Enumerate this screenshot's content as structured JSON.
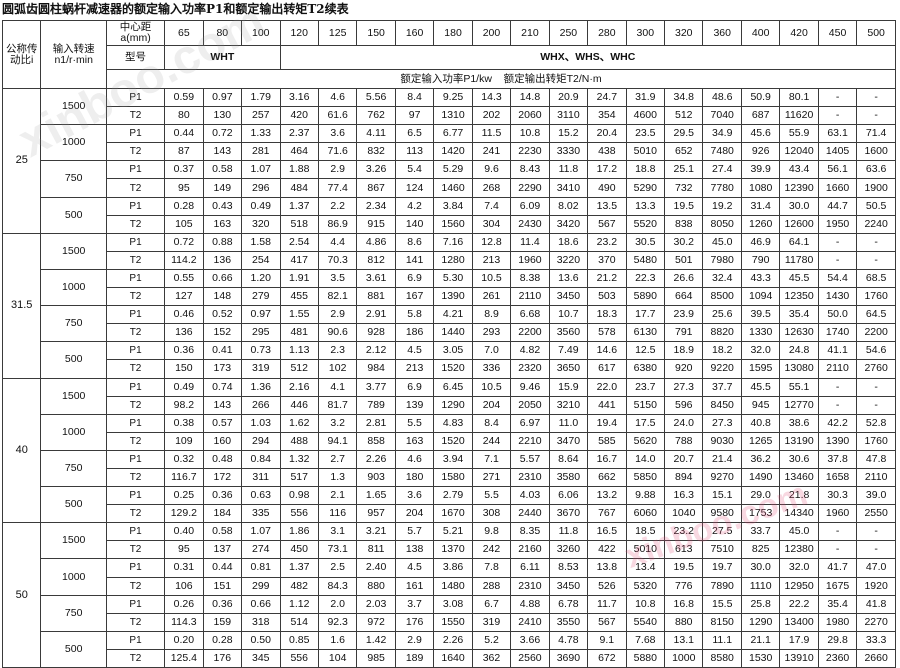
{
  "title": "圆弧齿圆柱蜗杆减速器的额定输入功率P1和额定输出转矩T2续表",
  "watermark_text": "xinboo.com",
  "header": {
    "ratio_label": "公称传动比i",
    "speed_label": "输入转速n1/r·min",
    "center_distance_label": "中心距a(mm)",
    "model_label": "型号",
    "center_distances": [
      "65",
      "80",
      "100",
      "120",
      "125",
      "150",
      "160",
      "180",
      "200",
      "210",
      "250",
      "280",
      "300",
      "320",
      "360",
      "400",
      "420",
      "450",
      "500"
    ],
    "models": [
      "WHT",
      "WHX、WHS、WHC"
    ],
    "units_caption": "额定输入功率P1/kw    额定输出转矩T2/N·m"
  },
  "groups": [
    {
      "ratio": "25",
      "speeds": [
        {
          "speed": "1500",
          "rows": [
            {
              "label": "P1",
              "values": [
                "0.59",
                "0.97",
                "1.79",
                "3.16",
                "4.6",
                "5.56",
                "8.4",
                "9.25",
                "14.3",
                "14.8",
                "20.9",
                "24.7",
                "31.9",
                "34.8",
                "48.6",
                "50.9",
                "80.1",
                "-",
                "-"
              ]
            },
            {
              "label": "T2",
              "values": [
                "80",
                "130",
                "257",
                "420",
                "61.6",
                "762",
                "97",
                "1310",
                "202",
                "2060",
                "3110",
                "354",
                "4600",
                "512",
                "7040",
                "687",
                "11620",
                "-",
                "-"
              ]
            }
          ]
        },
        {
          "speed": "1000",
          "rows": [
            {
              "label": "P1",
              "values": [
                "0.44",
                "0.72",
                "1.33",
                "2.37",
                "3.6",
                "4.11",
                "6.5",
                "6.77",
                "11.5",
                "10.8",
                "15.2",
                "20.4",
                "23.5",
                "29.5",
                "34.9",
                "45.6",
                "55.9",
                "63.1",
                "71.4"
              ]
            },
            {
              "label": "T2",
              "values": [
                "87",
                "143",
                "281",
                "464",
                "71.6",
                "832",
                "113",
                "1420",
                "241",
                "2230",
                "3330",
                "438",
                "5010",
                "652",
                "7480",
                "926",
                "12040",
                "1405",
                "1600"
              ]
            }
          ]
        },
        {
          "speed": "750",
          "rows": [
            {
              "label": "P1",
              "values": [
                "0.37",
                "0.58",
                "1.07",
                "1.88",
                "2.9",
                "3.26",
                "5.4",
                "5.29",
                "9.6",
                "8.43",
                "11.8",
                "17.2",
                "18.8",
                "25.1",
                "27.4",
                "39.9",
                "43.4",
                "56.1",
                "63.6"
              ]
            },
            {
              "label": "T2",
              "values": [
                "95",
                "149",
                "296",
                "484",
                "77.4",
                "867",
                "124",
                "1460",
                "268",
                "2290",
                "3410",
                "490",
                "5290",
                "732",
                "7780",
                "1080",
                "12390",
                "1660",
                "1900"
              ]
            }
          ]
        },
        {
          "speed": "500",
          "rows": [
            {
              "label": "P1",
              "values": [
                "0.28",
                "0.43",
                "0.49",
                "1.37",
                "2.2",
                "2.34",
                "4.2",
                "3.84",
                "7.4",
                "6.09",
                "8.02",
                "13.5",
                "13.3",
                "19.5",
                "19.2",
                "31.4",
                "30.0",
                "44.7",
                "50.5"
              ]
            },
            {
              "label": "T2",
              "values": [
                "105",
                "163",
                "320",
                "518",
                "86.9",
                "915",
                "140",
                "1560",
                "304",
                "2430",
                "3420",
                "567",
                "5520",
                "838",
                "8050",
                "1260",
                "12600",
                "1950",
                "2240"
              ]
            }
          ]
        }
      ]
    },
    {
      "ratio": "31.5",
      "speeds": [
        {
          "speed": "1500",
          "rows": [
            {
              "label": "P1",
              "values": [
                "0.72",
                "0.88",
                "1.58",
                "2.54",
                "4.4",
                "4.86",
                "8.6",
                "7.16",
                "12.8",
                "11.4",
                "18.6",
                "23.2",
                "30.5",
                "30.2",
                "45.0",
                "46.9",
                "64.1",
                "-",
                "-"
              ]
            },
            {
              "label": "T2",
              "values": [
                "114.2",
                "136",
                "254",
                "417",
                "70.3",
                "812",
                "141",
                "1280",
                "213",
                "1960",
                "3220",
                "370",
                "5480",
                "501",
                "7980",
                "790",
                "11780",
                "-",
                "-"
              ]
            }
          ]
        },
        {
          "speed": "1000",
          "rows": [
            {
              "label": "P1",
              "values": [
                "0.55",
                "0.66",
                "1.20",
                "1.91",
                "3.5",
                "3.61",
                "6.9",
                "5.30",
                "10.5",
                "8.38",
                "13.6",
                "21.2",
                "22.3",
                "26.6",
                "32.4",
                "43.3",
                "45.5",
                "54.4",
                "68.5"
              ]
            },
            {
              "label": "T2",
              "values": [
                "127",
                "148",
                "279",
                "455",
                "82.1",
                "881",
                "167",
                "1390",
                "261",
                "2110",
                "3450",
                "503",
                "5890",
                "664",
                "8500",
                "1094",
                "12350",
                "1430",
                "1760"
              ]
            }
          ]
        },
        {
          "speed": "750",
          "rows": [
            {
              "label": "P1",
              "values": [
                "0.46",
                "0.52",
                "0.97",
                "1.55",
                "2.9",
                "2.91",
                "5.8",
                "4.21",
                "8.9",
                "6.68",
                "10.7",
                "18.3",
                "17.7",
                "23.9",
                "25.6",
                "39.5",
                "35.4",
                "50.0",
                "64.5"
              ]
            },
            {
              "label": "T2",
              "values": [
                "136",
                "152",
                "295",
                "481",
                "90.6",
                "928",
                "186",
                "1440",
                "293",
                "2200",
                "3560",
                "578",
                "6130",
                "791",
                "8820",
                "1330",
                "12630",
                "1740",
                "2200"
              ]
            }
          ]
        },
        {
          "speed": "500",
          "rows": [
            {
              "label": "P1",
              "values": [
                "0.36",
                "0.41",
                "0.73",
                "1.13",
                "2.3",
                "2.12",
                "4.5",
                "3.05",
                "7.0",
                "4.82",
                "7.49",
                "14.6",
                "12.5",
                "18.9",
                "18.2",
                "32.0",
                "24.8",
                "41.1",
                "54.6"
              ]
            },
            {
              "label": "T2",
              "values": [
                "150",
                "173",
                "319",
                "512",
                "102",
                "984",
                "213",
                "1520",
                "336",
                "2320",
                "3650",
                "617",
                "6380",
                "920",
                "9220",
                "1595",
                "13080",
                "2110",
                "2760"
              ]
            }
          ]
        }
      ]
    },
    {
      "ratio": "40",
      "speeds": [
        {
          "speed": "1500",
          "rows": [
            {
              "label": "P1",
              "values": [
                "0.49",
                "0.74",
                "1.36",
                "2.16",
                "4.1",
                "3.77",
                "6.9",
                "6.45",
                "10.5",
                "9.46",
                "15.9",
                "22.0",
                "23.7",
                "27.3",
                "37.7",
                "45.5",
                "55.1",
                "-",
                "-"
              ]
            },
            {
              "label": "T2",
              "values": [
                "98.2",
                "143",
                "266",
                "446",
                "81.7",
                "789",
                "139",
                "1290",
                "204",
                "2050",
                "3210",
                "441",
                "5150",
                "596",
                "8450",
                "945",
                "12770",
                "-",
                "-"
              ]
            }
          ]
        },
        {
          "speed": "1000",
          "rows": [
            {
              "label": "P1",
              "values": [
                "0.38",
                "0.57",
                "1.03",
                "1.62",
                "3.2",
                "2.81",
                "5.5",
                "4.83",
                "8.4",
                "6.97",
                "11.0",
                "19.4",
                "17.5",
                "24.0",
                "27.3",
                "40.8",
                "38.6",
                "42.2",
                "52.8"
              ]
            },
            {
              "label": "T2",
              "values": [
                "109",
                "160",
                "294",
                "488",
                "94.1",
                "858",
                "163",
                "1520",
                "244",
                "2210",
                "3470",
                "585",
                "5620",
                "788",
                "9030",
                "1265",
                "13190",
                "1390",
                "1760"
              ]
            }
          ]
        },
        {
          "speed": "750",
          "rows": [
            {
              "label": "P1",
              "values": [
                "0.32",
                "0.48",
                "0.84",
                "1.32",
                "2.7",
                "2.26",
                "4.6",
                "3.94",
                "7.1",
                "5.57",
                "8.64",
                "16.7",
                "14.0",
                "20.7",
                "21.4",
                "36.2",
                "30.6",
                "37.8",
                "47.8"
              ]
            },
            {
              "label": "T2",
              "values": [
                "116.7",
                "172",
                "311",
                "517",
                "1.3",
                "903",
                "180",
                "1580",
                "271",
                "2310",
                "3580",
                "662",
                "5850",
                "894",
                "9270",
                "1490",
                "13460",
                "1658",
                "2110"
              ]
            }
          ]
        },
        {
          "speed": "500",
          "rows": [
            {
              "label": "P1",
              "values": [
                "0.25",
                "0.36",
                "0.63",
                "0.98",
                "2.1",
                "1.65",
                "3.6",
                "2.79",
                "5.5",
                "4.03",
                "6.06",
                "13.2",
                "9.88",
                "16.3",
                "15.1",
                "29.0",
                "21.8",
                "30.3",
                "39.0"
              ]
            },
            {
              "label": "T2",
              "values": [
                "129.2",
                "184",
                "335",
                "556",
                "116",
                "957",
                "204",
                "1670",
                "308",
                "2440",
                "3670",
                "767",
                "6060",
                "1040",
                "9580",
                "1753",
                "14340",
                "1960",
                "2550"
              ]
            }
          ]
        }
      ]
    },
    {
      "ratio": "50",
      "speeds": [
        {
          "speed": "1500",
          "rows": [
            {
              "label": "P1",
              "values": [
                "0.40",
                "0.58",
                "1.07",
                "1.86",
                "3.1",
                "3.21",
                "5.7",
                "5.21",
                "9.8",
                "8.35",
                "11.8",
                "16.5",
                "18.5",
                "23.2",
                "27.5",
                "33.7",
                "45.0",
                "-",
                "-"
              ]
            },
            {
              "label": "T2",
              "values": [
                "95",
                "137",
                "274",
                "450",
                "73.1",
                "811",
                "138",
                "1370",
                "242",
                "2160",
                "3260",
                "422",
                "5010",
                "613",
                "7510",
                "825",
                "12380",
                "-",
                "-"
              ]
            }
          ]
        },
        {
          "speed": "1000",
          "rows": [
            {
              "label": "P1",
              "values": [
                "0.31",
                "0.44",
                "0.81",
                "1.37",
                "2.5",
                "2.40",
                "4.5",
                "3.86",
                "7.8",
                "6.11",
                "8.53",
                "13.8",
                "13.4",
                "19.5",
                "19.7",
                "30.0",
                "32.0",
                "41.7",
                "47.0"
              ]
            },
            {
              "label": "T2",
              "values": [
                "106",
                "151",
                "299",
                "482",
                "84.3",
                "880",
                "161",
                "1480",
                "288",
                "2310",
                "3450",
                "526",
                "5320",
                "776",
                "7890",
                "1110",
                "12950",
                "1675",
                "1920"
              ]
            }
          ]
        },
        {
          "speed": "750",
          "rows": [
            {
              "label": "P1",
              "values": [
                "0.26",
                "0.36",
                "0.66",
                "1.12",
                "2.0",
                "2.03",
                "3.7",
                "3.08",
                "6.7",
                "4.88",
                "6.78",
                "11.7",
                "10.8",
                "16.8",
                "15.5",
                "25.8",
                "22.2",
                "35.4",
                "41.8"
              ]
            },
            {
              "label": "T2",
              "values": [
                "114.3",
                "159",
                "318",
                "514",
                "92.3",
                "972",
                "176",
                "1550",
                "319",
                "2410",
                "3550",
                "567",
                "5540",
                "880",
                "8150",
                "1290",
                "13400",
                "1980",
                "2270"
              ]
            }
          ]
        },
        {
          "speed": "500",
          "rows": [
            {
              "label": "P1",
              "values": [
                "0.20",
                "0.28",
                "0.50",
                "0.85",
                "1.6",
                "1.42",
                "2.9",
                "2.26",
                "5.2",
                "3.66",
                "4.78",
                "9.1",
                "7.68",
                "13.1",
                "11.1",
                "21.1",
                "17.9",
                "29.8",
                "33.3"
              ]
            },
            {
              "label": "T2",
              "values": [
                "125.4",
                "176",
                "345",
                "556",
                "104",
                "985",
                "189",
                "1640",
                "362",
                "2560",
                "3690",
                "672",
                "5880",
                "1000",
                "8580",
                "1530",
                "13910",
                "2360",
                "2660"
              ]
            }
          ]
        }
      ]
    }
  ]
}
